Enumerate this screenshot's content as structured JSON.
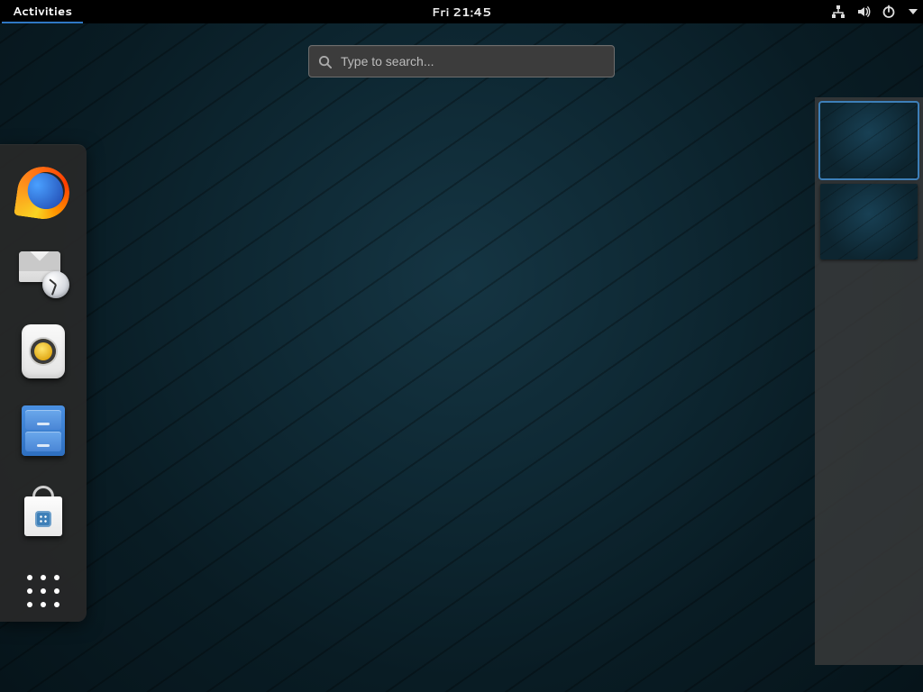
{
  "topbar": {
    "activities_label": "Activities",
    "clock": "Fri 21:45",
    "tray": {
      "network_icon": "network-wired-icon",
      "volume_icon": "volume-icon",
      "power_icon": "power-icon",
      "caret_icon": "chevron-down-icon"
    }
  },
  "search": {
    "placeholder": "Type to search...",
    "value": ""
  },
  "dash": {
    "apps": [
      {
        "name": "firefox",
        "icon": "firefox-icon"
      },
      {
        "name": "evolution",
        "icon": "mail-clock-icon"
      },
      {
        "name": "rhythmbox",
        "icon": "speaker-icon"
      },
      {
        "name": "files",
        "icon": "file-cabinet-icon"
      },
      {
        "name": "software",
        "icon": "shopping-bag-icon"
      }
    ],
    "show_apps_icon": "apps-grid-icon"
  },
  "workspaces": {
    "count": 2,
    "active_index": 0
  },
  "colors": {
    "accent": "#3d7fb8",
    "panel": "#000000",
    "dash_bg": "rgba(40,40,40,0.92)"
  }
}
